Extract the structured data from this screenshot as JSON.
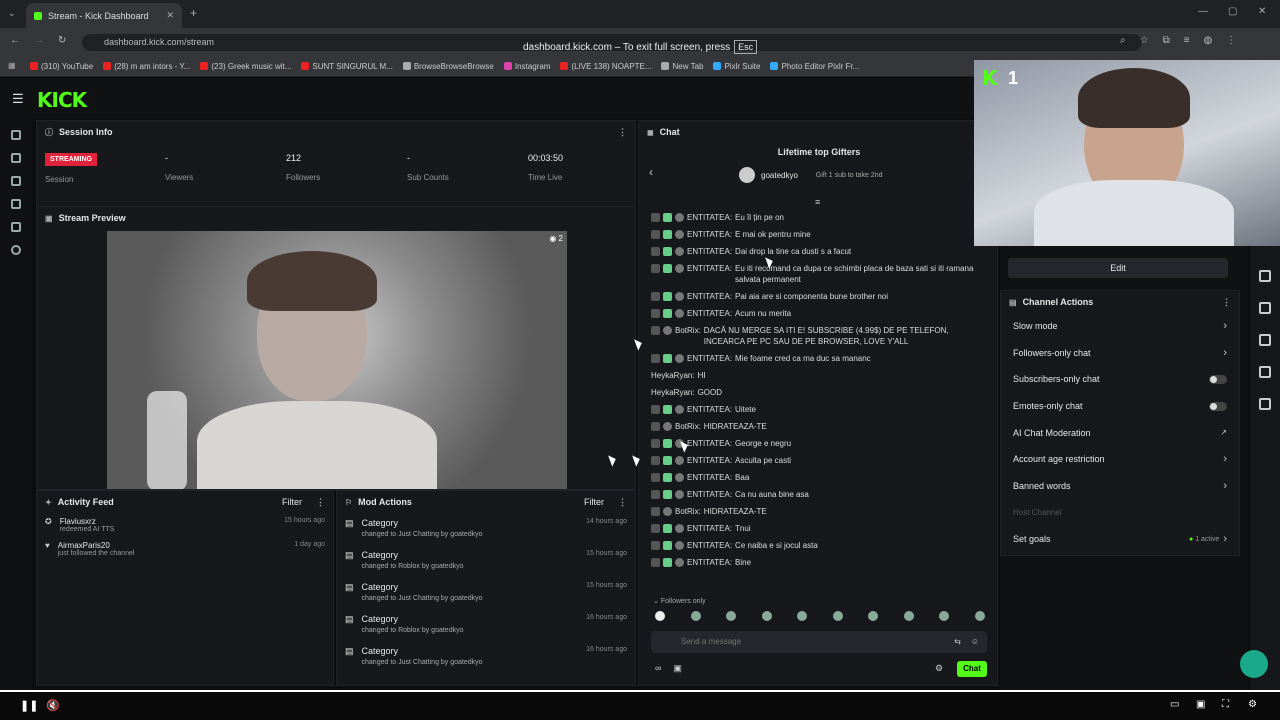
{
  "browser": {
    "tab_title": "Stream - Kick Dashboard",
    "url": "dashboard.kick.com/stream",
    "fullscreen_notice": "dashboard.kick.com – To exit full screen, press",
    "esc_key": "Esc",
    "bookmarks": [
      {
        "label": "(310) YouTube",
        "color": "#e22"
      },
      {
        "label": "(28) m am intors - Y...",
        "color": "#e22"
      },
      {
        "label": "(23) Greek music wit...",
        "color": "#e22"
      },
      {
        "label": "SUNT SINGURUL M...",
        "color": "#e22"
      },
      {
        "label": "BrowseBrowseBrowse",
        "color": "#aaa"
      },
      {
        "label": "Instagram",
        "color": "#d4a"
      },
      {
        "label": "(LIVE 138) NOAPTE...",
        "color": "#e22"
      },
      {
        "label": "New Tab",
        "color": "#aaa"
      },
      {
        "label": "Pixlr Suite",
        "color": "#3af"
      },
      {
        "label": "Photo Editor Pixlr Fr...",
        "color": "#3af"
      }
    ]
  },
  "app": {
    "logo": "KICK"
  },
  "session": {
    "title": "Session Info",
    "status": "STREAMING",
    "status_label": "Session",
    "viewers_value": "-",
    "viewers_label": "Viewers",
    "followers_value": "212",
    "followers_label": "Followers",
    "subs_value": "-",
    "subs_label": "Sub Counts",
    "time_value": "00:03:50",
    "time_label": "Time Live"
  },
  "preview": {
    "title": "Stream Preview",
    "viewer_count": "2"
  },
  "activity": {
    "title": "Activity Feed",
    "filter": "Filter",
    "items": [
      {
        "user": "Flaviusxrz",
        "text": "redeemed AI TTS",
        "time": "15 hours ago"
      },
      {
        "user": "AirmaxParis20",
        "text": "just followed the channel",
        "time": "1 day ago"
      }
    ]
  },
  "mod": {
    "title": "Mod Actions",
    "filter": "Filter",
    "items": [
      {
        "title": "Category",
        "text": "changed to Just Chatting by goatedkyo",
        "time": "14 hours ago"
      },
      {
        "title": "Category",
        "text": "changed to Roblox by goatedkyo",
        "time": "15 hours ago"
      },
      {
        "title": "Category",
        "text": "changed to Just Chatting by goatedkyo",
        "time": "15 hours ago"
      },
      {
        "title": "Category",
        "text": "changed to Roblox by goatedkyo",
        "time": "16 hours ago"
      },
      {
        "title": "Category",
        "text": "changed to Just Chatting by goatedkyo",
        "time": "16 hours ago"
      }
    ]
  },
  "chat": {
    "title": "Chat",
    "gifters_title": "Lifetime top Gifters",
    "top_gifter": "goatedkyo",
    "gift_hint": "Gift 1 sub to take 2nd",
    "messages": [
      {
        "user": "ENTITATEA:",
        "text": "Eu îl țin pe on",
        "badges": 3
      },
      {
        "user": "ENTITATEA:",
        "text": "E mai ok pentru mine",
        "badges": 3
      },
      {
        "user": "ENTITATEA:",
        "text": "Dai drop la tine ca dusti s a facut",
        "badges": 3
      },
      {
        "user": "ENTITATEA:",
        "text": "Eu iti recomand ca dupa ce schimbi placa de baza sati si iti ramana salvata permanent",
        "badges": 3
      },
      {
        "user": "ENTITATEA:",
        "text": "Pai aia are si componenta bune brother noi",
        "badges": 3
      },
      {
        "user": "ENTITATEA:",
        "text": "Acum nu merita",
        "badges": 3
      },
      {
        "user": "BotRix:",
        "text": "DACĂ NU MERGE SA ITI E! SUBSCRIBE (4.99$) DE PE TELEFON, INCEARCA PE PC SAU DE PE BROWSER, LOVE Y'ALL",
        "badges": 2
      },
      {
        "user": "ENTITATEA:",
        "text": "Mie foame cred ca ma duc sa mananc",
        "badges": 3
      },
      {
        "user": "HeykaRyan:",
        "text": "HI",
        "badges": 0
      },
      {
        "user": "HeykaRyan:",
        "text": "GOOD",
        "badges": 0
      },
      {
        "user": "ENTITATEA:",
        "text": "Uitete",
        "badges": 3
      },
      {
        "user": "BotRix:",
        "text": "HIDRATEAZA-TE",
        "badges": 2
      },
      {
        "user": "ENTITATEA:",
        "text": "George e negru",
        "badges": 3
      },
      {
        "user": "ENTITATEA:",
        "text": "Asculta pe casti",
        "badges": 3
      },
      {
        "user": "ENTITATEA:",
        "text": "Baa",
        "badges": 3
      },
      {
        "user": "ENTITATEA:",
        "text": "Ca nu auna bine asa",
        "badges": 3
      },
      {
        "user": "BotRix:",
        "text": "HIDRATEAZA-TE",
        "badges": 2
      },
      {
        "user": "ENTITATEA:",
        "text": "Tnui",
        "badges": 3
      },
      {
        "user": "ENTITATEA:",
        "text": "Ce naiba e si jocul asta",
        "badges": 3
      },
      {
        "user": "ENTITATEA:",
        "text": "Bine",
        "badges": 3
      }
    ],
    "followers_only_notice": "Followers only",
    "input_placeholder": "Send a message",
    "send_button": "Chat"
  },
  "channel": {
    "edit_button": "Edit",
    "title": "Channel Actions",
    "settings": [
      {
        "label": "Slow mode",
        "control": "chevron"
      },
      {
        "label": "Followers-only chat",
        "control": "chevron"
      },
      {
        "label": "Subscribers-only chat",
        "control": "toggle"
      },
      {
        "label": "Emotes-only chat",
        "control": "toggle"
      },
      {
        "label": "AI Chat Moderation",
        "control": "link"
      },
      {
        "label": "Account age restriction",
        "control": "chevron"
      },
      {
        "label": "Banned words",
        "control": "chevron"
      },
      {
        "label": "Host Channel",
        "control": "none"
      },
      {
        "label": "Set goals",
        "control": "chevron",
        "badge": "1 active"
      }
    ]
  },
  "webcam": {
    "overlay_number": "1"
  },
  "colors": {
    "accent": "#53fc18",
    "live": "#e0223a"
  }
}
